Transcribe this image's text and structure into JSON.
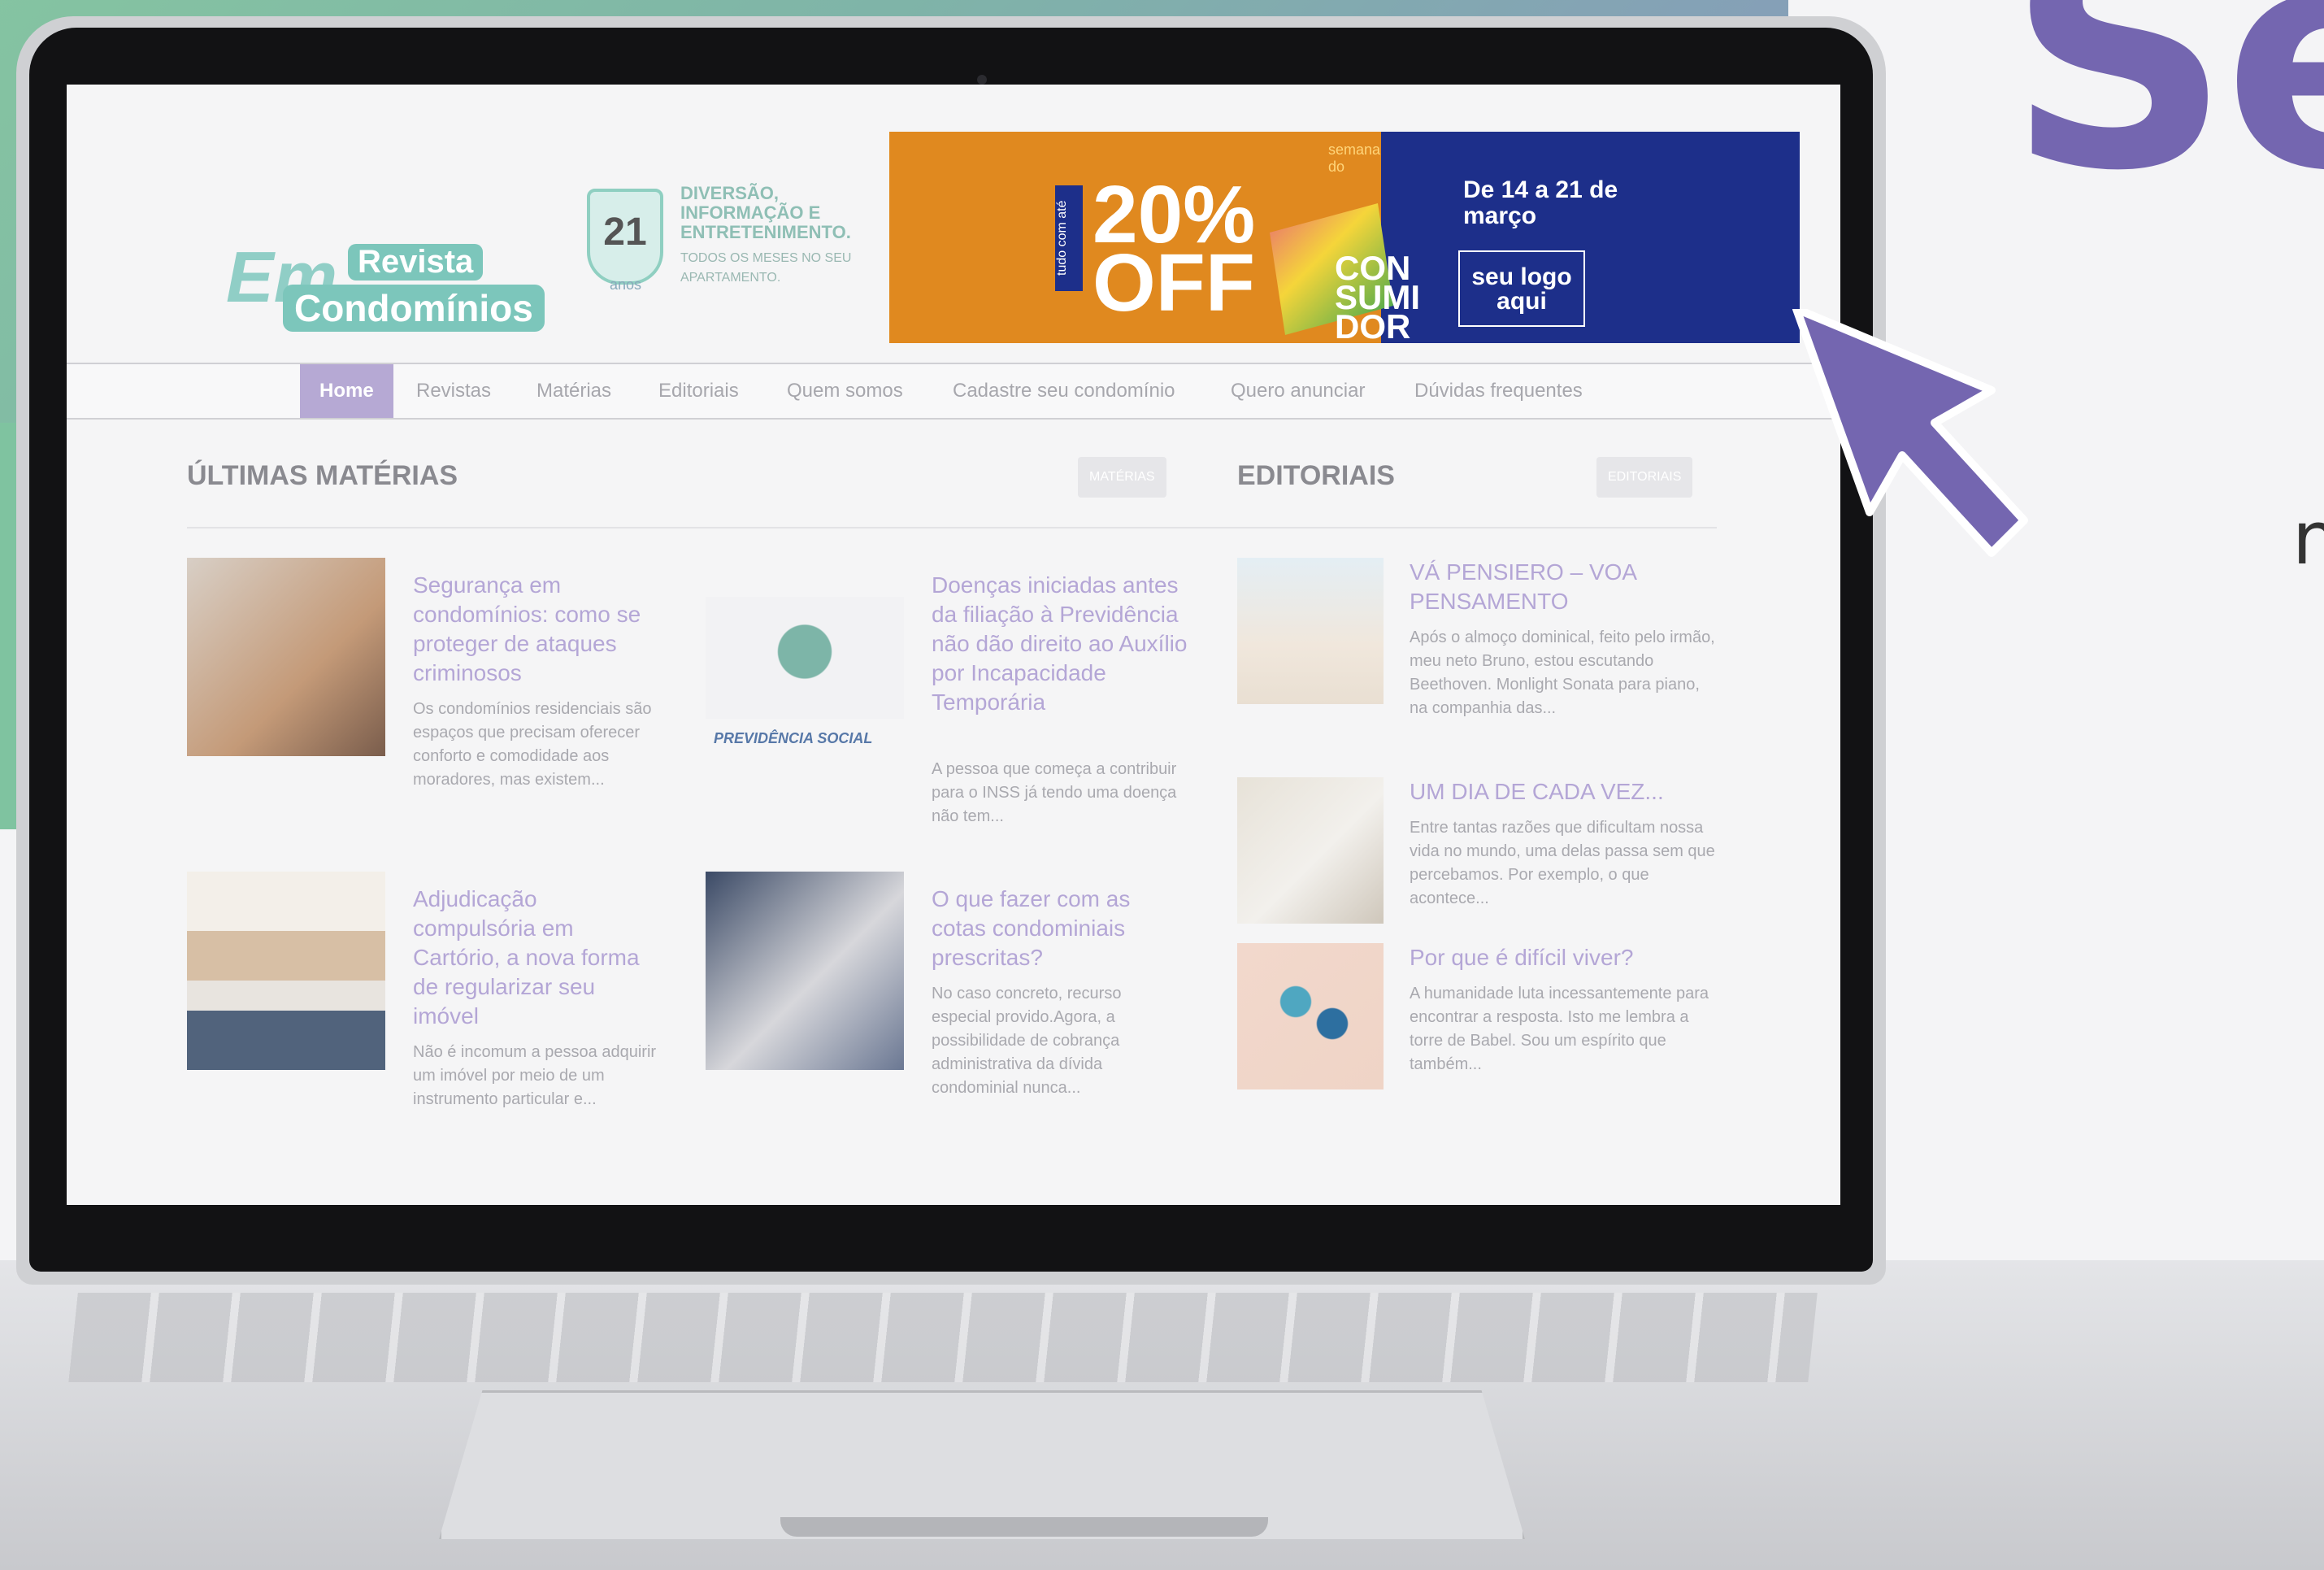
{
  "hero": {
    "partial_word": "Se",
    "side_letter": "n"
  },
  "site": {
    "logo": {
      "em": "Em",
      "revista": "Revista",
      "condominios": "Condomínios"
    },
    "badge": {
      "number": "21",
      "unit": "anos"
    },
    "tagline": {
      "line1": "DIVERSÃO, INFORMAÇÃO E ENTRETENIMENTO.",
      "line2": "TODOS OS MESES NO SEU APARTAMENTO."
    },
    "banner": {
      "tudo": "tudo com até",
      "percent": "20%",
      "off": "OFF",
      "semana": "semana do",
      "date": "De 14 a 21 de março",
      "consumidor": "CON SUMI DOR",
      "logo": "seu logo aqui"
    },
    "nav": [
      "Home",
      "Revistas",
      "Matérias",
      "Editoriais",
      "Quem somos",
      "Cadastre seu condomínio",
      "Quero anunciar",
      "Dúvidas frequentes"
    ],
    "latest": {
      "title": "ÚLTIMAS MATÉRIAS",
      "button": "MATÉRIAS",
      "items": [
        {
          "title": "Segurança em condomínios: como se proteger de ataques criminosos",
          "excerpt": "Os condomínios residenciais são espaços que precisam oferecer conforto e comodidade aos moradores, mas existem..."
        },
        {
          "title": "Doenças iniciadas antes da filiação à Previdência não dão direito ao Auxílio por Incapacidade Temporária",
          "excerpt": "A pessoa que começa a contribuir para o INSS já tendo uma doença não tem...",
          "image_label": "PREVIDÊNCIA SOCIAL"
        },
        {
          "title": "Adjudicação compulsória em Cartório, a nova forma de regularizar seu imóvel",
          "excerpt": "Não é incomum a pessoa adquirir um imóvel por meio de um instrumento particular e..."
        },
        {
          "title": "O que fazer com as cotas condominiais prescritas?",
          "excerpt": "No caso concreto, recurso especial provido.Agora, a possibilidade de cobrança administrativa da dívida condominial nunca..."
        }
      ]
    },
    "editorials": {
      "title": "EDITORIAIS",
      "button": "EDITORIAIS",
      "items": [
        {
          "title": "VÁ PENSIERO – VOA PENSAMENTO",
          "excerpt": "Após o almoço dominical, feito pelo irmão, meu neto Bruno, estou escutando Beethoven. Monlight Sonata para piano, na companhia das..."
        },
        {
          "title": "UM DIA DE CADA VEZ...",
          "excerpt": "Entre tantas razões que dificultam nossa vida no mundo, uma delas passa sem que percebamos. Por exemplo, o que acontece..."
        },
        {
          "title": "Por que é difícil viver?",
          "excerpt": "A humanidade luta incessantemente para encontrar a resposta. Isto me lembra a torre de Babel. Sou um espírito que também..."
        }
      ]
    }
  },
  "colors": {
    "accent": "#7466b0",
    "green": "#86c7a0",
    "nav_active": "#b6a9d4"
  }
}
